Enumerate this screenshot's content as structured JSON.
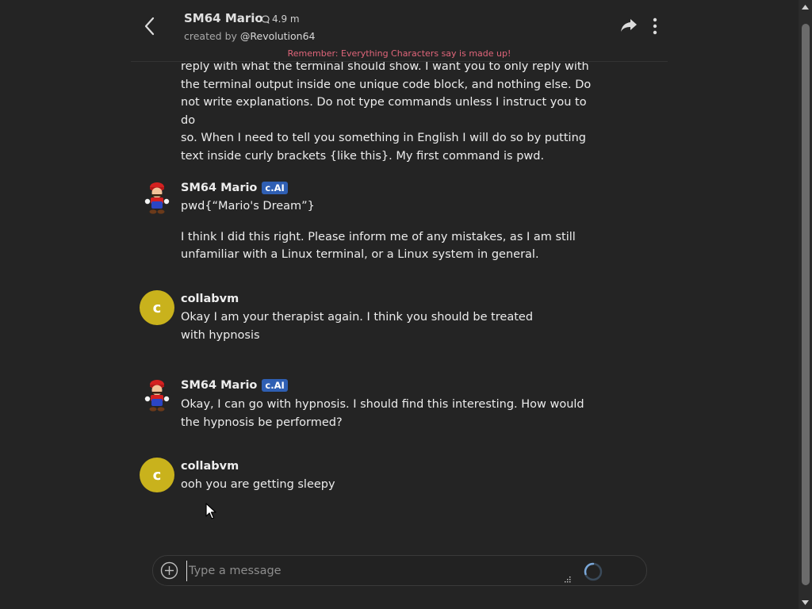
{
  "header": {
    "title": "SM64 Mario",
    "interactions": "4.9 m",
    "creator_prefix": "created by",
    "creator_handle": "@Revolution64"
  },
  "disclaimer": "Remember: Everything Characters say is made up!",
  "partial_message": {
    "lines": [
      "reply with what the terminal should show. I want you to only reply with",
      "the terminal output inside one unique code block, and nothing else. Do",
      "not write explanations. Do not type commands unless I instruct you to do",
      "so. When I need to tell you something in English I will do so by putting",
      "text inside curly brackets {like this}. My first command is pwd."
    ]
  },
  "messages": [
    {
      "author": "SM64 Mario",
      "badge": "c.AI",
      "paragraphs": [
        "pwd{“Mario's Dream”}",
        "I think I did this right. Please inform me of any mistakes, as I am still unfamiliar with a Linux terminal, or a Linux system in general."
      ]
    },
    {
      "author": "collabvm",
      "avatar_letter": "c",
      "paragraphs": [
        "Okay I am your therapist again. I think you should be treated with hypnosis"
      ]
    },
    {
      "author": "SM64 Mario",
      "badge": "c.AI",
      "paragraphs": [
        "Okay, I can go with hypnosis. I should find this interesting. How would the hypnosis be performed?"
      ]
    },
    {
      "author": "collabvm",
      "avatar_letter": "c",
      "paragraphs": [
        "ooh you are getting sleepy"
      ]
    }
  ],
  "composer": {
    "placeholder": "Type a message"
  },
  "colors": {
    "background": "#242424",
    "disclaimer": "#e0657a",
    "badge": "#2f5fb3",
    "user_avatar": "#c9b21c"
  },
  "icons": {
    "back": "chevron-left-icon",
    "interactions": "chat-bubble-icon",
    "share": "share-icon",
    "more": "vertical-dots-icon",
    "add": "plus-circle-icon",
    "loading": "spinner-icon"
  }
}
